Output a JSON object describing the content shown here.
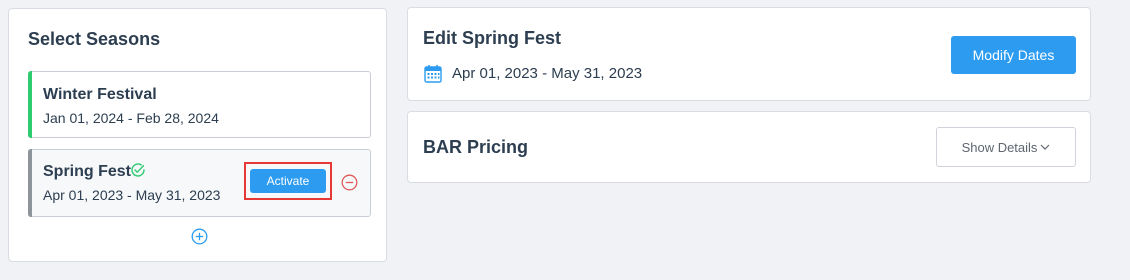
{
  "select_seasons": {
    "title": "Select Seasons",
    "seasons": [
      {
        "name": "Winter Festival",
        "dates": "Jan 01, 2024 - Feb 28, 2024"
      },
      {
        "name": "Spring Fest",
        "dates": "Apr 01, 2023 - May 31, 2023",
        "activate_label": "Activate"
      }
    ]
  },
  "edit": {
    "title": "Edit Spring Fest",
    "dates": "Apr 01, 2023 - May 31, 2023",
    "modify_label": "Modify Dates"
  },
  "bar_pricing": {
    "title": "BAR Pricing",
    "details_label": "Show Details"
  },
  "colors": {
    "accent": "#2d9cf0",
    "active_bar": "#2ecc71",
    "inactive_bar": "#8e949c",
    "highlight": "#e53935",
    "danger": "#e05a5a"
  },
  "icons": [
    "check-circle-icon",
    "minus-circle-icon",
    "plus-circle-icon",
    "calendar-icon",
    "chevron-down-icon"
  ]
}
